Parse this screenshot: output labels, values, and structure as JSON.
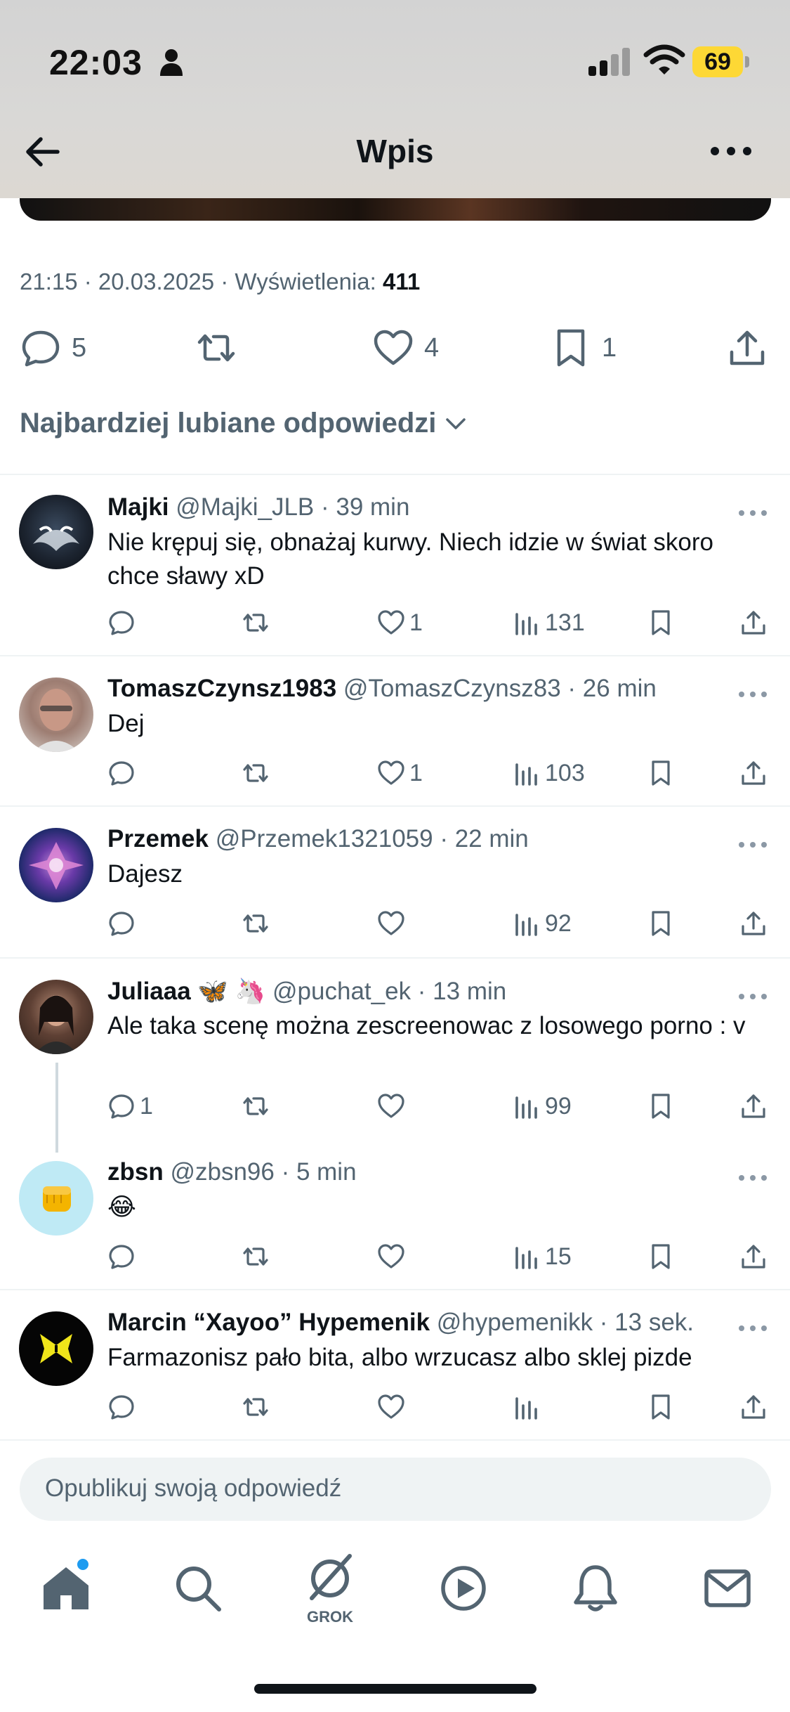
{
  "status_bar": {
    "time": "22:03",
    "battery": "69"
  },
  "header": {
    "title": "Wpis"
  },
  "post": {
    "timestamp": "21:15 · 20.03.2025 · Wyświetlenia:",
    "views": "411",
    "replies": "5",
    "likes": "4",
    "bookmarks": "1"
  },
  "sort": {
    "label": "Najbardziej lubiane odpowiedzi"
  },
  "replies": [
    {
      "name": "Majki",
      "handle": "@Majki_JLB · 39 min",
      "text": "Nie krępuj się, obnażaj kurwy. Niech idzie w świat skoro chce sławy xD",
      "replies": "",
      "likes": "1",
      "views": "131"
    },
    {
      "name": "TomaszCzynsz1983",
      "handle": "@TomaszCzynsz83 · 26 min",
      "text": "Dej",
      "replies": "",
      "likes": "1",
      "views": "103"
    },
    {
      "name": "Przemek",
      "handle": "@Przemek1321059 · 22 min",
      "text": "Dajesz",
      "replies": "",
      "likes": "",
      "views": "92"
    },
    {
      "name": "Juliaaa 🦋 🦄",
      "handle": "@puchat_ek · 13 min",
      "text": "Ale taka scenę można zescreenowac z losowego porno : v",
      "replies": "1",
      "likes": "",
      "views": "99"
    },
    {
      "name": "zbsn",
      "handle": "@zbsn96 · 5 min",
      "text": "😂",
      "replies": "",
      "likes": "",
      "views": "15"
    },
    {
      "name": "Marcin “Xayoo” Hypemenik",
      "handle": "@hypemenikk · 13 sek.",
      "text": "Farmazonisz pało bita, albo wrzucasz albo sklej pizde",
      "replies": "",
      "likes": "",
      "views": ""
    }
  ],
  "composer": {
    "placeholder": "Opublikuj swoją odpowiedź"
  },
  "tabbar": {
    "grok_label": "GROK"
  },
  "colors": {
    "accent": "#1d9bf0",
    "text_secondary": "#536471",
    "battery": "#fdd835"
  }
}
